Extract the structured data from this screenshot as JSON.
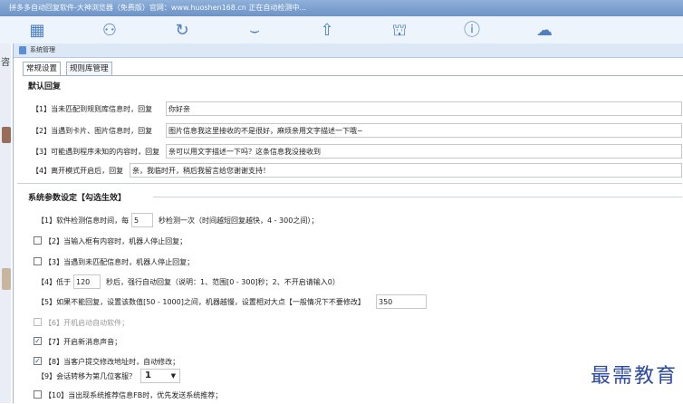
{
  "app": {
    "title": "拼多多自动回复软件-大神浏览器（免费版）官网：www.huoshen168.cn  正在自动检测中..."
  },
  "toolbar": {
    "icons": [
      "grid-icon",
      "user-icon",
      "refresh-icon",
      "eye-icon",
      "upload-icon",
      "cart-icon",
      "help-icon",
      "cloud-icon"
    ]
  },
  "side": {
    "char": "咨"
  },
  "dialog": {
    "title": "系统管理"
  },
  "tabs": [
    "常规设置",
    "规则库管理"
  ],
  "default_reply": {
    "heading": "默认回复",
    "rows": [
      {
        "label": "【1】当未匹配到规则库信息时，回复",
        "value": "你好亲"
      },
      {
        "label": "【2】当遇到卡片、图片信息时，回复",
        "value": "图片信息我这里接收的不是很好，麻烦亲用文字描述一下哦~"
      },
      {
        "label": "【3】可能遇到程序未知的内容时，回复",
        "value": "亲可以用文字描述一下吗？这条信息我没接收到"
      },
      {
        "label": "【4】离开模式开启后，回复",
        "value": "亲，我临时开，稍后我留言给您谢谢支持！"
      }
    ]
  },
  "system": {
    "heading": "系统参数设定【勾选生效】",
    "r1": {
      "pre": "【1】软件检测信息时间，每",
      "value": "5",
      "post": "秒检测一次（时间越短回复越快，4 - 300之间）；"
    },
    "r2": {
      "label": "【2】当输入框有内容时，机器人停止回复；",
      "checked": false
    },
    "r3": {
      "label": "【3】当遇到未匹配信息时，机器人停止回复；",
      "checked": false
    },
    "r4": {
      "pre": "【4】低于",
      "value": "120",
      "post": "秒后，强行自动回复（说明：1、范围[0 - 300]秒；2、不开启请输入0）"
    },
    "r5": {
      "pre": "【5】如果不能回复，设置该数值[50 - 1000]之间，机器越慢，设置相对大点【一般情况下不要修改】",
      "value": "350"
    },
    "r6": {
      "label": "【6】开机启动自动软件；",
      "checked": false,
      "disabled": true
    },
    "r7": {
      "label": "【7】开启新消息声音；",
      "checked": true
    },
    "r8": {
      "label": "【8】当客户提交修改地址时，自动修改；",
      "checked": true
    },
    "r9": {
      "pre": "【9】会话转移为第几位客服？",
      "value": "1"
    },
    "r10": {
      "label": "【10】当出现系统推荐信息FB时，优先发送系统推荐；",
      "checked": false
    }
  },
  "watermark": "最需教育"
}
